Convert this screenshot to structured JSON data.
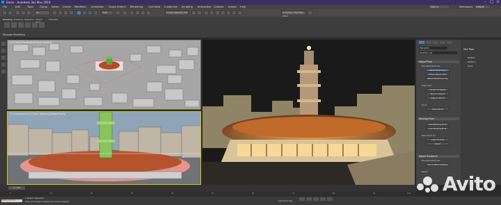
{
  "window": {
    "title": "Eman - Autodesk 3ds Max 2019",
    "sign_in": "Sign In",
    "workspace_label": "Workspaces:",
    "workspace_value": "Default"
  },
  "menu": [
    "File",
    "Edit",
    "Tools",
    "Group",
    "Views",
    "Create",
    "Modifiers",
    "Animation",
    "Graph Editors",
    "Rendering",
    "Civil View",
    "Customize",
    "Scripting",
    "Interactive",
    "Content",
    "Arnold",
    "Help"
  ],
  "toolbar": {
    "selection_set": "Create Selection Set",
    "view_dropdown": "View"
  },
  "ribbon": {
    "tabs": [
      "Modeling",
      "Freeform",
      "Selection",
      "Object Paint",
      "Populate"
    ],
    "panel_label": "Polygon Modeling"
  },
  "viewports": {
    "top_label": "[+] [Top] [Standard] [Default Shading]",
    "persp_label": "[+] [CameraCam01] [User Defined] [Edged Faces]"
  },
  "command_panel": {
    "object_name": "Plane001",
    "modifier_list": "Modifier List",
    "sections": [
      "Adjust Pivot",
      "Alignment",
      "Pivot",
      "Working Pivot",
      "Adjust Transform"
    ],
    "buttons": [
      "Affect Pivot Only",
      "Affect Object Only",
      "Affect Hierarchy Only",
      "Center to Object",
      "Align to Object",
      "Align to World",
      "Reset Pivot",
      "Edit Working Pivot",
      "Use Working Pivot",
      "Place Pivot To:",
      "Align To View",
      "Reset",
      "Don't Affect Children"
    ],
    "move_rotate_scale": "Move/Rotate/Scale:",
    "reset_label": "Reset:"
  },
  "side_panel": {
    "header": "Skin Pose",
    "items": [
      "Position",
      "Rotation",
      "Scale"
    ]
  },
  "timeline": {
    "frame": "0 / 100",
    "ticks": [
      "0",
      "10",
      "20",
      "30",
      "40",
      "50",
      "60",
      "70",
      "80",
      "90",
      "100"
    ]
  },
  "status": {
    "line1": "1 Object Selected",
    "line2": "Click and drag to select and move objects",
    "maxscript": "MAXScript Mini",
    "add_time_tag": "Add Time Tag"
  },
  "watermark": "Avito",
  "colors": {
    "title_bg": "#3a2e62",
    "active_tab": "#4a7fc1",
    "selected_viewport": "#d9c500"
  }
}
